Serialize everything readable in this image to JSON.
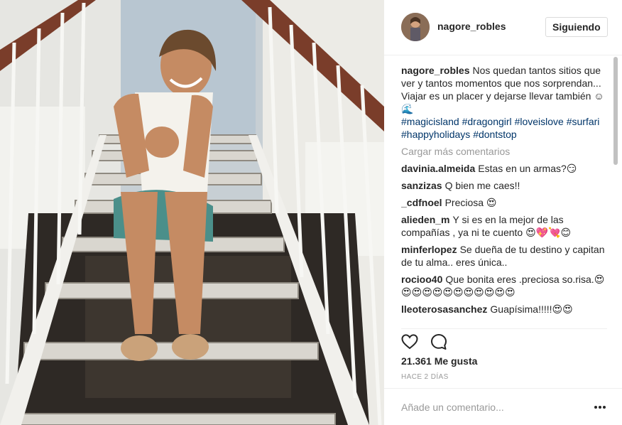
{
  "post": {
    "image_alt": "woman-sitting-on-stairs"
  },
  "header": {
    "username": "nagore_robles",
    "follow_label": "Siguiendo"
  },
  "caption": {
    "user": "nagore_robles",
    "line1": "Nos quedan tantos sitios que ver y tantos momentos que nos sorprendan...",
    "line2": "Viajar es un placer y dejarse llevar también ☺🌊",
    "hashtags": [
      "#magicisland",
      "#dragongirl",
      "#loveislove",
      "#surfari",
      "#happyholidays",
      "#dontstop"
    ]
  },
  "load_more": "Cargar más comentarios",
  "comments": [
    {
      "user": "davinia.almeida",
      "text": "Estas en un armas?😏"
    },
    {
      "user": "sanzizas",
      "text": "Q bien me caes!!"
    },
    {
      "user": "_cdfnoel",
      "text": "Preciosa 😍"
    },
    {
      "user": "alieden_m",
      "text": "Y si es en la mejor de las compañías , ya ni te cuento 😍💖💘😊"
    },
    {
      "user": "minferlopez",
      "text": "Se dueña de tu destino y capitan de tu alma.. eres única.."
    },
    {
      "user": "rocioo40",
      "text": "Que bonita eres .preciosa so.risa.😍😍😍😍😍😍😍😍😍😍😍😍"
    },
    {
      "user": "lleoterosasanchez",
      "text": "Guapísima!!!!!😍😍"
    }
  ],
  "likes": "21.361 Me gusta",
  "time_ago": "HACE 2 DÍAS",
  "add_comment_placeholder": "Añade un comentario...",
  "colors": {
    "link": "#003569",
    "muted": "#999999",
    "text": "#262626",
    "border": "#efefef"
  },
  "icons": {
    "like": "heart-icon",
    "comment": "speech-bubble-icon",
    "more": "ellipsis-icon"
  }
}
